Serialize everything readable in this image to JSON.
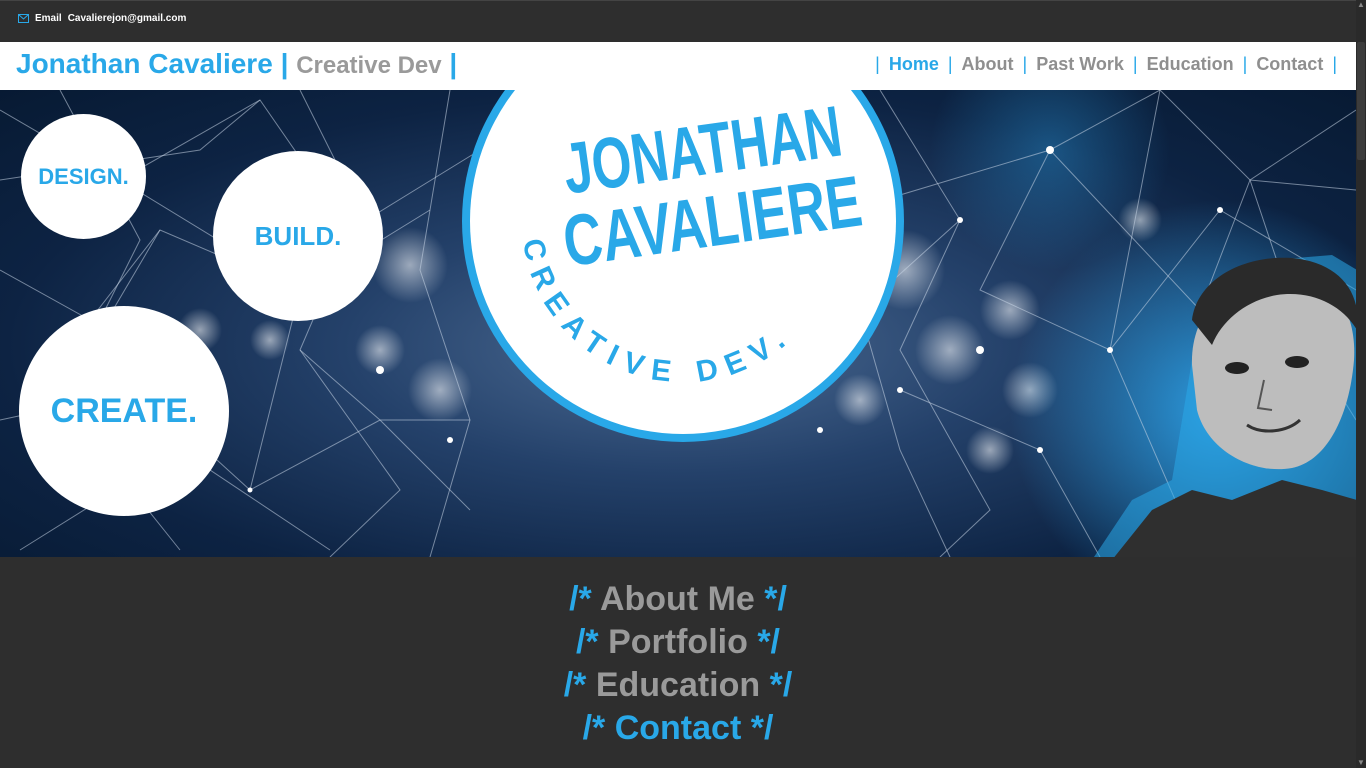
{
  "topbar": {
    "email_label": "Email",
    "email_address": "Cavalierejon@gmail.com",
    "icon": "envelope-icon"
  },
  "brand": {
    "name": "Jonathan Cavaliere",
    "pipe": "|",
    "tagline": "Creative Dev",
    "pipe2": "|"
  },
  "nav": {
    "separator": "|",
    "links": [
      "Home",
      "About",
      "Past Work",
      "Education",
      "Contact"
    ],
    "active": "Home"
  },
  "hero": {
    "bubbles": [
      "DESIGN.",
      "BUILD.",
      "CREATE."
    ],
    "logo": {
      "line1": "JONATHAN",
      "line2": "CAVALIERE",
      "arc": "CREATIVE DEV."
    }
  },
  "sections": {
    "open": "/*",
    "close": "*/",
    "items": [
      "About Me",
      "Portfolio",
      "Education",
      "Contact"
    ]
  },
  "colors": {
    "accent": "#29a8e8",
    "dark_bg": "#2e2e2e",
    "muted_text": "#9a9a9a"
  }
}
